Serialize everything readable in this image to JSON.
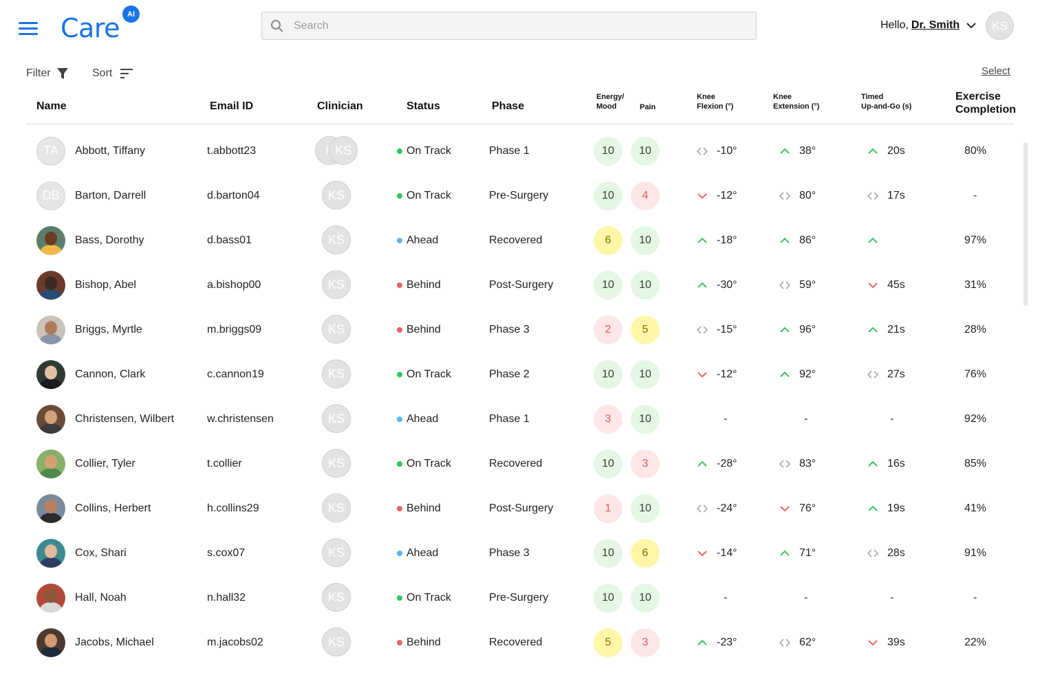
{
  "app": {
    "logo_text": "Care",
    "logo_badge": "AI"
  },
  "header": {
    "search_placeholder": "Search",
    "greeting_prefix": "Hello,",
    "user_name": "Dr. Smith",
    "user_initials": "KS"
  },
  "toolbar": {
    "filter_label": "Filter",
    "sort_label": "Sort",
    "select_label": "Select"
  },
  "columns": {
    "name": "Name",
    "email": "Email ID",
    "clinician": "Clinician",
    "status": "Status",
    "phase": "Phase",
    "energy_1": "Energy/",
    "energy_2": "Mood",
    "pain": "Pain",
    "flexion_1": "Knee",
    "flexion_2": "Flexion (°)",
    "extension_1": "Knee",
    "extension_2": "Extension (°)",
    "tug_1": "Timed",
    "tug_2": "Up-and-Go (s)",
    "exercise_1": "Exercise",
    "exercise_2": "Completion"
  },
  "colors": {
    "brand": "#1a73e8",
    "on_track": "#34c759",
    "ahead": "#5ab4f0",
    "behind": "#f06262",
    "score_green_bg": "#e3f7e3",
    "score_red_bg": "#fde6e6",
    "score_yellow_bg": "#fff7a6"
  },
  "patients": [
    {
      "initials": "TA",
      "name": "Abbott, Tiffany",
      "email": "t.abbott23",
      "clinicians": [
        "K",
        "KS"
      ],
      "status": "On Track",
      "status_key": "on_track",
      "phase": "Phase 1",
      "energy": "10",
      "energy_level": "green",
      "pain": "10",
      "pain_level": "green",
      "flex_trend": "neutral",
      "flex": "-10°",
      "ext_trend": "up",
      "ext": "38°",
      "tug_trend": "up",
      "tug": "20s",
      "exercise": "80%"
    },
    {
      "initials": "DB",
      "name": "Barton, Darrell",
      "email": "d.barton04",
      "clinicians": [
        "KS"
      ],
      "status": "On Track",
      "status_key": "on_track",
      "phase": "Pre-Surgery",
      "energy": "10",
      "energy_level": "green",
      "pain": "4",
      "pain_level": "red",
      "flex_trend": "down",
      "flex": "-12°",
      "ext_trend": "neutral",
      "ext": "80°",
      "tug_trend": "neutral",
      "tug": "17s",
      "exercise": "-"
    },
    {
      "photo": "p3",
      "name": "Bass, Dorothy",
      "email": "d.bass01",
      "clinicians": [
        "KS"
      ],
      "status": "Ahead",
      "status_key": "ahead",
      "phase": "Recovered",
      "energy": "6",
      "energy_level": "yellow",
      "pain": "10",
      "pain_level": "green",
      "flex_trend": "up",
      "flex": "-18°",
      "ext_trend": "up",
      "ext": "86°",
      "tug_trend": "up",
      "tug": "",
      "exercise": "97%"
    },
    {
      "photo": "p4",
      "name": "Bishop, Abel",
      "email": "a.bishop00",
      "clinicians": [
        "KS"
      ],
      "status": "Behind",
      "status_key": "behind",
      "phase": "Post-Surgery",
      "energy": "10",
      "energy_level": "green",
      "pain": "10",
      "pain_level": "green",
      "flex_trend": "up",
      "flex": "-30°",
      "ext_trend": "neutral",
      "ext": "59°",
      "tug_trend": "down",
      "tug": "45s",
      "exercise": "31%"
    },
    {
      "photo": "p5",
      "name": "Briggs, Myrtle",
      "email": "m.briggs09",
      "clinicians": [
        "KS"
      ],
      "status": "Behind",
      "status_key": "behind",
      "phase": "Phase 3",
      "energy": "2",
      "energy_level": "red",
      "pain": "5",
      "pain_level": "yellow",
      "flex_trend": "neutral",
      "flex": "-15°",
      "ext_trend": "up",
      "ext": "96°",
      "tug_trend": "up",
      "tug": "21s",
      "exercise": "28%"
    },
    {
      "photo": "p6",
      "name": "Cannon, Clark",
      "email": "c.cannon19",
      "clinicians": [
        "KS"
      ],
      "status": "On Track",
      "status_key": "on_track",
      "phase": "Phase 2",
      "energy": "10",
      "energy_level": "green",
      "pain": "10",
      "pain_level": "green",
      "flex_trend": "down",
      "flex": "-12°",
      "ext_trend": "up",
      "ext": "92°",
      "tug_trend": "neutral",
      "tug": "27s",
      "exercise": "76%"
    },
    {
      "photo": "p7",
      "name": "Christensen, Wilbert",
      "email": "w.christensen",
      "clinicians": [
        "KS"
      ],
      "status": "Ahead",
      "status_key": "ahead",
      "phase": "Phase 1",
      "energy": "3",
      "energy_level": "red",
      "pain": "10",
      "pain_level": "green",
      "flex_trend": "none",
      "flex": "-",
      "ext_trend": "none",
      "ext": "-",
      "tug_trend": "none",
      "tug": "-",
      "exercise": "92%"
    },
    {
      "photo": "p8",
      "name": "Collier, Tyler",
      "email": "t.collier",
      "clinicians": [
        "KS"
      ],
      "status": "On Track",
      "status_key": "on_track",
      "phase": "Recovered",
      "energy": "10",
      "energy_level": "green",
      "pain": "3",
      "pain_level": "red",
      "flex_trend": "up",
      "flex": "-28°",
      "ext_trend": "neutral",
      "ext": "83°",
      "tug_trend": "up",
      "tug": "16s",
      "exercise": "85%"
    },
    {
      "photo": "p9",
      "name": "Collins, Herbert",
      "email": "h.collins29",
      "clinicians": [
        "KS"
      ],
      "status": "Behind",
      "status_key": "behind",
      "phase": "Post-Surgery",
      "energy": "1",
      "energy_level": "red",
      "pain": "10",
      "pain_level": "green",
      "flex_trend": "neutral",
      "flex": "-24°",
      "ext_trend": "down",
      "ext": "76°",
      "tug_trend": "up",
      "tug": "19s",
      "exercise": "41%"
    },
    {
      "photo": "p10",
      "name": "Cox, Shari",
      "email": "s.cox07",
      "clinicians": [
        "KS"
      ],
      "status": "Ahead",
      "status_key": "ahead",
      "phase": "Phase 3",
      "energy": "10",
      "energy_level": "green",
      "pain": "6",
      "pain_level": "yellow",
      "flex_trend": "down",
      "flex": "-14°",
      "ext_trend": "up",
      "ext": "71°",
      "tug_trend": "neutral",
      "tug": "28s",
      "exercise": "91%"
    },
    {
      "photo": "p11",
      "name": "Hall, Noah",
      "email": "n.hall32",
      "clinicians": [
        "KS"
      ],
      "status": "On Track",
      "status_key": "on_track",
      "phase": "Pre-Surgery",
      "energy": "10",
      "energy_level": "green",
      "pain": "10",
      "pain_level": "green",
      "flex_trend": "none",
      "flex": "-",
      "ext_trend": "none",
      "ext": "-",
      "tug_trend": "none",
      "tug": "-",
      "exercise": "-"
    },
    {
      "photo": "p12",
      "name": "Jacobs, Michael",
      "email": "m.jacobs02",
      "clinicians": [
        "KS"
      ],
      "status": "Behind",
      "status_key": "behind",
      "phase": "Recovered",
      "energy": "5",
      "energy_level": "yellow",
      "pain": "3",
      "pain_level": "red",
      "flex_trend": "up",
      "flex": "-23°",
      "ext_trend": "neutral",
      "ext": "62°",
      "tug_trend": "down",
      "tug": "39s",
      "exercise": "22%"
    }
  ]
}
